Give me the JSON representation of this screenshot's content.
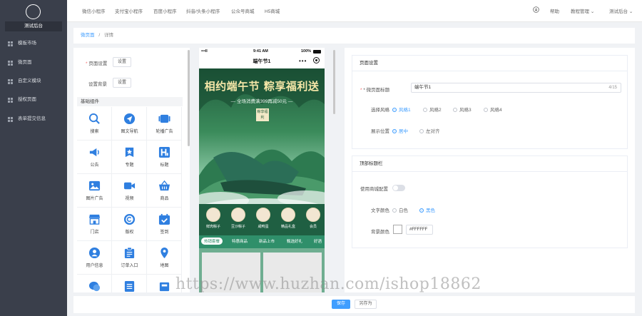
{
  "app": {
    "brand": "测试后台",
    "colors": {
      "accent": "#409eff",
      "sidebar": "#3a3f4b",
      "theme_green": "#2f8f6a"
    }
  },
  "sidebar": {
    "items": [
      {
        "label": "模板市场",
        "icon": "grid-icon"
      },
      {
        "label": "微页面",
        "icon": "grid-icon"
      },
      {
        "label": "自定义模块",
        "icon": "grid-icon"
      },
      {
        "label": "授权页面",
        "icon": "grid-icon"
      },
      {
        "label": "表单提交信息",
        "icon": "grid-icon"
      }
    ]
  },
  "topbar": {
    "nav": [
      "微信小程序",
      "支付宝小程序",
      "百度小程序",
      "抖音/头条小程序",
      "公众号商城",
      "H5商城"
    ],
    "right": {
      "download_icon": "download-icon",
      "help": "帮助",
      "course": "教程管理",
      "account": "测试后台"
    }
  },
  "breadcrumb": {
    "root": "微页面",
    "separator": "/",
    "current": "详情"
  },
  "left_panel": {
    "page_settings_label": "页面设置",
    "page_settings_btn": "设置",
    "page_bg_label": "设置背景",
    "page_bg_btn": "设置",
    "components_header": "基础组件",
    "components": [
      {
        "label": "搜索",
        "icon": "search-icon"
      },
      {
        "label": "图文导航",
        "icon": "navigation-icon"
      },
      {
        "label": "轮播广告",
        "icon": "carousel-icon"
      },
      {
        "label": "公告",
        "icon": "megaphone-icon"
      },
      {
        "label": "专题",
        "icon": "star-badge-icon"
      },
      {
        "label": "标题",
        "icon": "heading-icon"
      },
      {
        "label": "图片广告",
        "icon": "image-icon"
      },
      {
        "label": "视频",
        "icon": "video-icon"
      },
      {
        "label": "商品",
        "icon": "basket-icon"
      },
      {
        "label": "门店",
        "icon": "store-icon"
      },
      {
        "label": "版权",
        "icon": "copyright-icon"
      },
      {
        "label": "签到",
        "icon": "calendar-check-icon"
      },
      {
        "label": "用户信息",
        "icon": "user-icon"
      },
      {
        "label": "订单入口",
        "icon": "clipboard-icon"
      },
      {
        "label": "地图",
        "icon": "map-pin-icon"
      },
      {
        "label": "",
        "icon": "chat-icon"
      },
      {
        "label": "",
        "icon": "list-icon"
      },
      {
        "label": "",
        "icon": "box-icon"
      }
    ]
  },
  "phone": {
    "status": {
      "signal": "•••ll",
      "time": "9:41 AM",
      "battery": "100%"
    },
    "title": "端午节1",
    "banner": {
      "headline": "相约端午节 粽享福利送",
      "subline": "— 全场消费满399再减50元 —",
      "tag": "粽享福利"
    },
    "categories": [
      "鲜肉粽子",
      "豆沙粽子",
      "咸鸭蛋",
      "精品礼盒",
      "会员"
    ],
    "tabs": [
      "热销套餐",
      "特惠商品",
      "新品上市",
      "甄选好礼",
      "好酒"
    ]
  },
  "right_panel": {
    "page_section_title": "页面设置",
    "title_label": "* 微页面标题",
    "title_value": "端午节1",
    "title_count": "4/15",
    "style_label": "选择风格",
    "styles": [
      "风格1",
      "风格2",
      "风格3",
      "风格4"
    ],
    "style_selected": 0,
    "position_label": "展示位置",
    "positions": [
      "居中",
      "左对齐"
    ],
    "position_selected": 0,
    "top_section_title": "顶部标题栏",
    "custom_label": "使用商城配置",
    "text_color_label": "文字颜色",
    "text_colors": [
      "白色",
      "黑色"
    ],
    "text_color_selected": 1,
    "bg_color_label": "背景颜色",
    "bg_color_value": "#FFFFFF"
  },
  "bottom": {
    "save": "保存",
    "save_as": "另存为"
  },
  "watermark": "https://www.huzhan.com/ishop18862"
}
